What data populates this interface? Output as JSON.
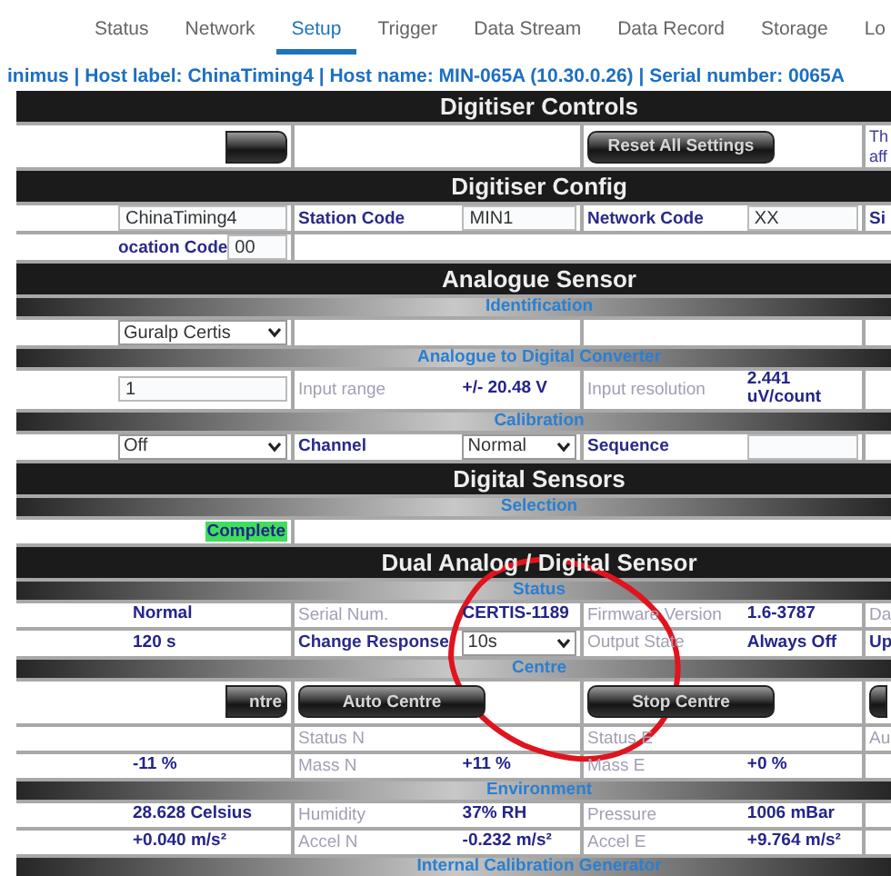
{
  "tabs": [
    {
      "label": "Status",
      "selected": false
    },
    {
      "label": "Network",
      "selected": false
    },
    {
      "label": "Setup",
      "selected": true
    },
    {
      "label": "Trigger",
      "selected": false
    },
    {
      "label": "Data Stream",
      "selected": false
    },
    {
      "label": "Data Record",
      "selected": false
    },
    {
      "label": "Storage",
      "selected": false
    },
    {
      "label": "Lo",
      "selected": false
    }
  ],
  "host_info": "inimus | Host label: ChinaTiming4 | Host name: MIN-065A (10.30.0.26) | Serial number: 0065A",
  "annotation": {
    "kind": "circle"
  },
  "sections": [
    {
      "title": "Digitiser Controls",
      "rows": [
        {
          "kind": "buttons",
          "cells": [
            {
              "kind": "button"
            },
            {
              "kind": "empty"
            },
            {
              "kind": "button",
              "value": "Reset All Settings"
            },
            {
              "kind": "note",
              "lines": [
                "Th",
                "aff"
              ]
            }
          ]
        }
      ]
    },
    {
      "title": "Digitiser Config",
      "rows": [
        {
          "kind": "cells",
          "cells": [
            {
              "kind": "input",
              "value": "ChinaTiming4"
            },
            {
              "label": "Station Code",
              "strong": true,
              "kind": "input",
              "value": "MIN1"
            },
            {
              "label": "Network Code",
              "strong": true,
              "kind": "input",
              "value": "XX"
            },
            {
              "label": "Si",
              "strong": true,
              "kind": "empty"
            }
          ]
        },
        {
          "kind": "cells",
          "cells": [
            {
              "label": "ocation Code",
              "strong": true,
              "kind": "input",
              "value": "00"
            },
            {
              "kind": "empty"
            }
          ]
        }
      ]
    },
    {
      "title": "Analogue Sensor",
      "rows": [
        {
          "kind": "subheader",
          "title": "Identification"
        },
        {
          "kind": "cells",
          "cells": [
            {
              "kind": "select",
              "value": "Guralp Certis"
            },
            {
              "kind": "empty"
            },
            {
              "kind": "empty"
            },
            {
              "kind": "empty"
            }
          ]
        },
        {
          "kind": "subheader",
          "title": "Analogue to Digital Converter"
        },
        {
          "kind": "cells",
          "cells": [
            {
              "kind": "input",
              "value": "1"
            },
            {
              "label": "Input range",
              "strong": false,
              "kind": "text",
              "value": "+/- 20.48 V"
            },
            {
              "label": "Input resolution",
              "strong": false,
              "kind": "text",
              "value": "2.441 uV/count"
            },
            {
              "kind": "empty"
            }
          ]
        },
        {
          "kind": "subheader",
          "title": "Calibration"
        },
        {
          "kind": "cells",
          "cells": [
            {
              "kind": "select",
              "value": "Off"
            },
            {
              "label": "Channel",
              "strong": true,
              "kind": "select",
              "value": "Normal"
            },
            {
              "label": "Sequence",
              "strong": true,
              "kind": "input"
            },
            {
              "kind": "empty"
            }
          ]
        }
      ]
    },
    {
      "title": "Digital Sensors",
      "rows": [
        {
          "kind": "subheader",
          "title": "Selection"
        },
        {
          "kind": "cells",
          "cells": [
            {
              "kind": "status",
              "value": "Complete"
            },
            {
              "kind": "empty"
            }
          ]
        }
      ]
    },
    {
      "title": "Dual Analog / Digital Sensor",
      "rows": [
        {
          "kind": "subheader",
          "title": "Status"
        },
        {
          "kind": "cells",
          "cells": [
            {
              "kind": "text",
              "value": "Normal"
            },
            {
              "label": "Serial Num.",
              "strong": false,
              "kind": "text",
              "value": "CERTIS-1189"
            },
            {
              "label": "Firmware Version",
              "strong": false,
              "kind": "text",
              "value": "1.6-3787"
            },
            {
              "label": "Da",
              "strong": false,
              "kind": "empty"
            }
          ]
        },
        {
          "kind": "cells",
          "cells": [
            {
              "kind": "text",
              "value": "120 s"
            },
            {
              "label": "Change Response",
              "strong": true,
              "kind": "select",
              "value": "10s"
            },
            {
              "label": "Output State",
              "strong": false,
              "kind": "text",
              "value": "Always Off"
            },
            {
              "label": "Up",
              "strong": true,
              "kind": "empty"
            }
          ]
        },
        {
          "kind": "subheader",
          "title": "Centre"
        },
        {
          "kind": "buttons",
          "cells": [
            {
              "kind": "button",
              "value": "ntre"
            },
            {
              "kind": "button",
              "value": "Auto Centre"
            },
            {
              "kind": "button",
              "value": "Stop Centre"
            },
            {
              "kind": "button"
            }
          ]
        },
        {
          "kind": "cells",
          "cells": [
            {
              "kind": "empty"
            },
            {
              "label": "Status N",
              "strong": false,
              "kind": "empty"
            },
            {
              "label": "Status E",
              "strong": false,
              "kind": "empty"
            },
            {
              "label": "Au",
              "strong": false,
              "kind": "empty"
            }
          ]
        },
        {
          "kind": "cells",
          "cells": [
            {
              "kind": "text",
              "value": "-11 %"
            },
            {
              "label": "Mass N",
              "strong": false,
              "kind": "text",
              "value": "+11 %"
            },
            {
              "label": "Mass E",
              "strong": false,
              "kind": "text",
              "value": "+0 %"
            },
            {
              "kind": "empty"
            }
          ]
        },
        {
          "kind": "subheader",
          "title": "Environment"
        },
        {
          "kind": "cells",
          "cells": [
            {
              "kind": "text",
              "value": "28.628 Celsius"
            },
            {
              "label": "Humidity",
              "strong": false,
              "kind": "text",
              "value": "37% RH"
            },
            {
              "label": "Pressure",
              "strong": false,
              "kind": "text",
              "value": "1006 mBar"
            },
            {
              "kind": "empty"
            }
          ]
        },
        {
          "kind": "cells",
          "cells": [
            {
              "kind": "text",
              "value": "+0.040 m/s²"
            },
            {
              "label": "Accel N",
              "strong": false,
              "kind": "text",
              "value": "-0.232 m/s²"
            },
            {
              "label": "Accel E",
              "strong": false,
              "kind": "text",
              "value": "+9.764 m/s²"
            },
            {
              "kind": "empty"
            }
          ]
        },
        {
          "kind": "subheader",
          "title": "Internal Calibration Generator"
        }
      ]
    }
  ]
}
